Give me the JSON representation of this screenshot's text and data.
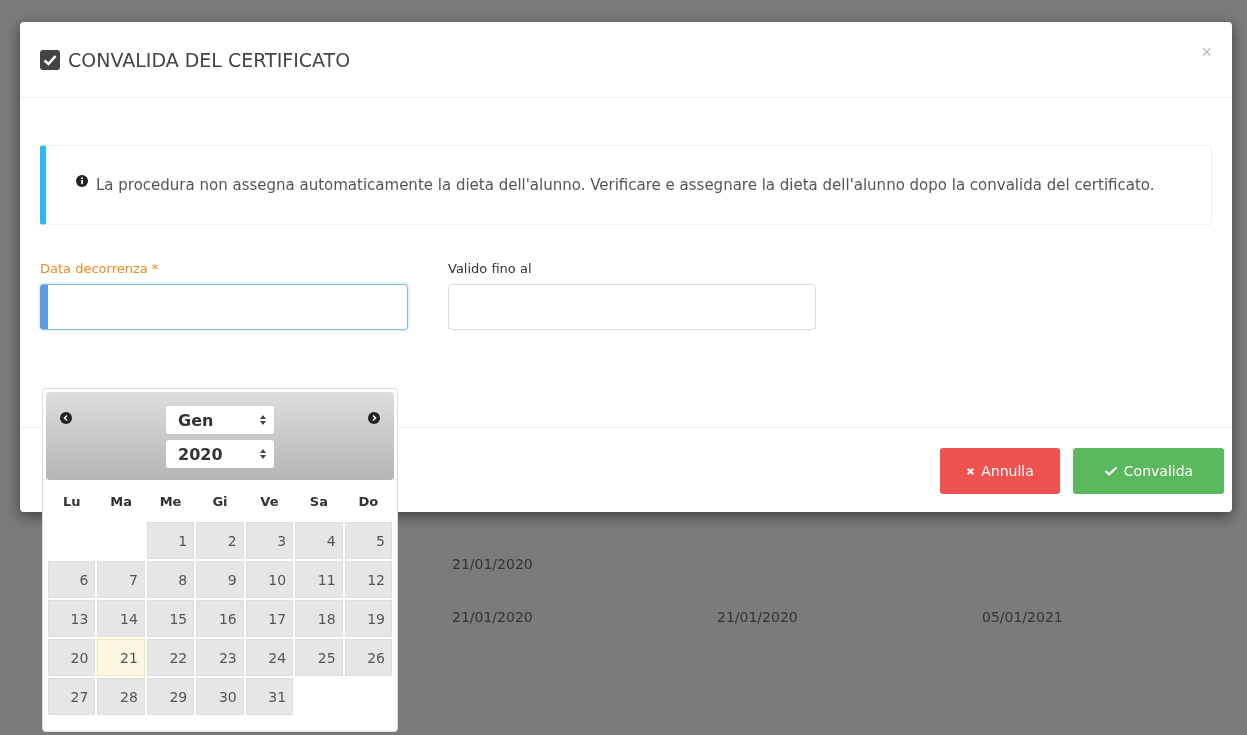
{
  "background_table": {
    "rows": [
      {
        "cells": [
          "21/01/2020"
        ]
      },
      {
        "cells": [
          "21/01/2020",
          "21/01/2020",
          "05/01/2021"
        ]
      }
    ]
  },
  "modal": {
    "title": "CONVALIDA DEL CERTIFICATO",
    "close": "×",
    "alert": {
      "text": "La procedura non assegna automaticamente la dieta dell'alunno. Verificare e assegnare la dieta dell'alunno dopo la convalida del certificato."
    },
    "fields": [
      {
        "label": "Data decorrenza",
        "required_mark": "*",
        "required": true,
        "focused": true
      },
      {
        "label": "Valido fino al",
        "required": false,
        "focused": false
      }
    ],
    "buttons": [
      {
        "kind": "cancel",
        "label": "Annulla"
      },
      {
        "kind": "confirm",
        "label": "Convalida"
      }
    ]
  },
  "datepicker": {
    "month": "Gen",
    "year": "2020",
    "weekdays": [
      "Lu",
      "Ma",
      "Me",
      "Gi",
      "Ve",
      "Sa",
      "Do"
    ],
    "weeks": [
      [
        {
          "kind": "empty"
        },
        {
          "kind": "empty"
        },
        {
          "day": "1",
          "today": false
        },
        {
          "day": "2",
          "today": false
        },
        {
          "day": "3",
          "today": false
        },
        {
          "day": "4",
          "today": false
        },
        {
          "day": "5",
          "today": false
        }
      ],
      [
        {
          "day": "6",
          "today": false
        },
        {
          "day": "7",
          "today": false
        },
        {
          "day": "8",
          "today": false
        },
        {
          "day": "9",
          "today": false
        },
        {
          "day": "10",
          "today": false
        },
        {
          "day": "11",
          "today": false
        },
        {
          "day": "12",
          "today": false
        }
      ],
      [
        {
          "day": "13",
          "today": false
        },
        {
          "day": "14",
          "today": false
        },
        {
          "day": "15",
          "today": false
        },
        {
          "day": "16",
          "today": false
        },
        {
          "day": "17",
          "today": false
        },
        {
          "day": "18",
          "today": false
        },
        {
          "day": "19",
          "today": false
        }
      ],
      [
        {
          "day": "20",
          "today": false
        },
        {
          "day": "21",
          "today": true
        },
        {
          "day": "22",
          "today": false
        },
        {
          "day": "23",
          "today": false
        },
        {
          "day": "24",
          "today": false
        },
        {
          "day": "25",
          "today": false
        },
        {
          "day": "26",
          "today": false
        }
      ],
      [
        {
          "day": "27",
          "today": false
        },
        {
          "day": "28",
          "today": false
        },
        {
          "day": "29",
          "today": false
        },
        {
          "day": "30",
          "today": false
        },
        {
          "day": "31",
          "today": false
        },
        {
          "kind": "empty"
        },
        {
          "kind": "empty"
        }
      ]
    ]
  }
}
